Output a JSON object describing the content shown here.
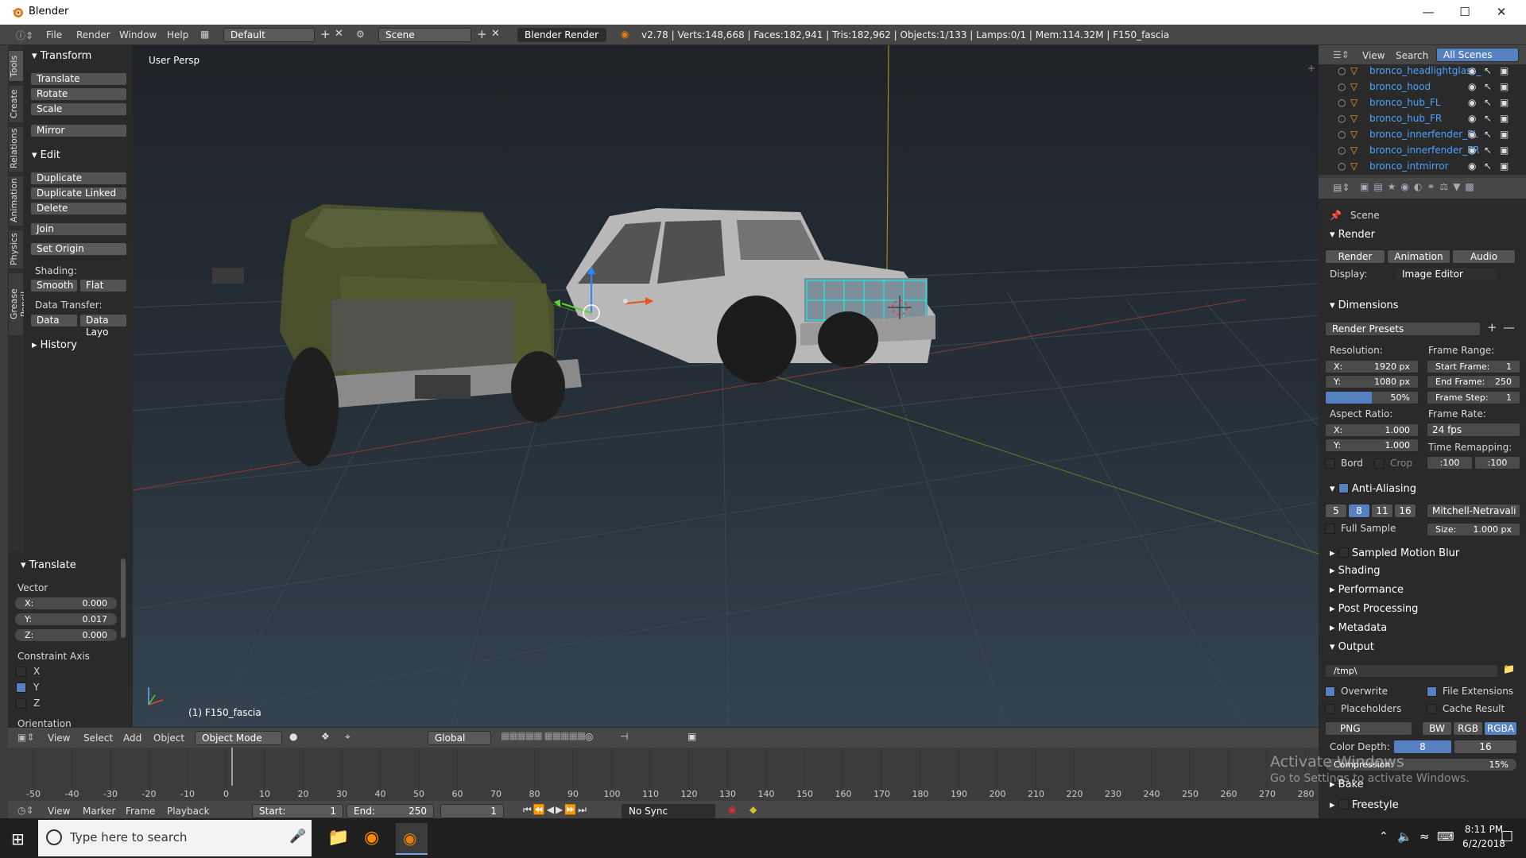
{
  "window": {
    "title": "Blender"
  },
  "menubar": {
    "items": [
      "File",
      "Render",
      "Window",
      "Help"
    ],
    "layout": "Default",
    "scene": "Scene",
    "engine": "Blender Render",
    "stats": "v2.78 | Verts:148,668 | Faces:182,941 | Tris:182,962 | Objects:1/133 | Lamps:0/1 | Mem:114.32M | F150_fascia"
  },
  "tabs": [
    "Tools",
    "Create",
    "Relations",
    "Animation",
    "Physics",
    "Grease Pencil"
  ],
  "toolshelf": {
    "transform_title": "Transform",
    "transform": [
      "Translate",
      "Rotate",
      "Scale",
      "Mirror"
    ],
    "edit_title": "Edit",
    "edit": [
      "Duplicate",
      "Duplicate Linked",
      "Delete",
      "Join",
      "Set Origin"
    ],
    "shading_label": "Shading:",
    "shading": [
      "Smooth",
      "Flat"
    ],
    "datatransfer_label": "Data Transfer:",
    "datatransfer": [
      "Data",
      "Data Layo"
    ],
    "history_title": "History"
  },
  "redo": {
    "title": "Translate",
    "vector_label": "Vector",
    "x": "X:",
    "x_val": "0.000",
    "y": "Y:",
    "y_val": "0.017",
    "z": "Z:",
    "z_val": "0.000",
    "constraint_label": "Constraint Axis",
    "axes": [
      "X",
      "Y",
      "Z"
    ],
    "orientation_label": "Orientation"
  },
  "viewport": {
    "view_name": "User Persp",
    "object_label": "(1) F150_fascia"
  },
  "viewheader": {
    "items": [
      "View",
      "Select",
      "Add",
      "Object"
    ],
    "mode": "Object Mode",
    "orientation": "Global"
  },
  "timeline": {
    "ticks": [
      "-50",
      "-40",
      "-30",
      "-20",
      "-10",
      "0",
      "10",
      "20",
      "30",
      "40",
      "50",
      "60",
      "70",
      "80",
      "90",
      "100",
      "110",
      "120",
      "130",
      "140",
      "150",
      "160",
      "170",
      "180",
      "190",
      "200",
      "210",
      "220",
      "230",
      "240",
      "250",
      "260",
      "270",
      "280"
    ],
    "items": [
      "View",
      "Marker",
      "Frame",
      "Playback"
    ],
    "start_label": "Start:",
    "start": "1",
    "end_label": "End:",
    "end": "250",
    "current": "1",
    "sync": "No Sync"
  },
  "outliner": {
    "menu": [
      "View",
      "Search",
      "All Scenes"
    ],
    "rows": [
      "bronco_headlightglass_",
      "bronco_hood",
      "bronco_hub_FL",
      "bronco_hub_FR",
      "bronco_innerfender_FL",
      "bronco_innerfender_FR",
      "bronco_intmirror"
    ]
  },
  "properties": {
    "context": "Scene",
    "render_title": "Render",
    "render_btn": "Render",
    "anim_btn": "Animation",
    "audio_btn": "Audio",
    "display_label": "Display:",
    "display_value": "Image Editor",
    "dimensions_title": "Dimensions",
    "presets": "Render Presets",
    "resolution_label": "Resolution:",
    "res_x": "X:",
    "res_x_val": "1920 px",
    "res_y": "Y:",
    "res_y_val": "1080 px",
    "res_pct": "50%",
    "frame_range_label": "Frame Range:",
    "start_frame": "Start Frame:",
    "start_frame_val": "1",
    "end_frame": "End Frame:",
    "end_frame_val": "250",
    "frame_step": "Frame Step:",
    "frame_step_val": "1",
    "aspect_label": "Aspect Ratio:",
    "asp_x": "X:",
    "asp_x_val": "1.000",
    "asp_y": "Y:",
    "asp_y_val": "1.000",
    "frame_rate_label": "Frame Rate:",
    "fps": "24 fps",
    "time_remap_label": "Time Remapping:",
    "remap_old": ":100",
    "remap_new": ":100",
    "bord": "Bord",
    "crop": "Crop",
    "aa_title": "Anti-Aliasing",
    "aa_samples": [
      "5",
      "8",
      "11",
      "16"
    ],
    "aa_filter": "Mitchell-Netravali",
    "full_sample": "Full Sample",
    "aa_size": "Size:",
    "aa_size_val": "1.000 px",
    "sections": [
      "Sampled Motion Blur",
      "Shading",
      "Performance",
      "Post Processing",
      "Metadata"
    ],
    "output_title": "Output",
    "output_path": "/tmp\\",
    "overwrite": "Overwrite",
    "file_ext": "File Extensions",
    "placeholders": "Placeholders",
    "cache": "Cache Result",
    "format": "PNG",
    "color_modes": [
      "BW",
      "RGB",
      "RGBA"
    ],
    "color_depth_label": "Color Depth:",
    "depth_8": "8",
    "depth_16": "16",
    "compression": "Compression:",
    "compression_val": "15%",
    "bake_title": "Bake",
    "freestyle_title": "Freestyle"
  },
  "watermark": {
    "line1": "Activate Windows",
    "line2": "Go to Settings to activate Windows."
  },
  "taskbar": {
    "search_placeholder": "Type here to search",
    "time": "8:11 PM",
    "date": "6/2/2018"
  }
}
